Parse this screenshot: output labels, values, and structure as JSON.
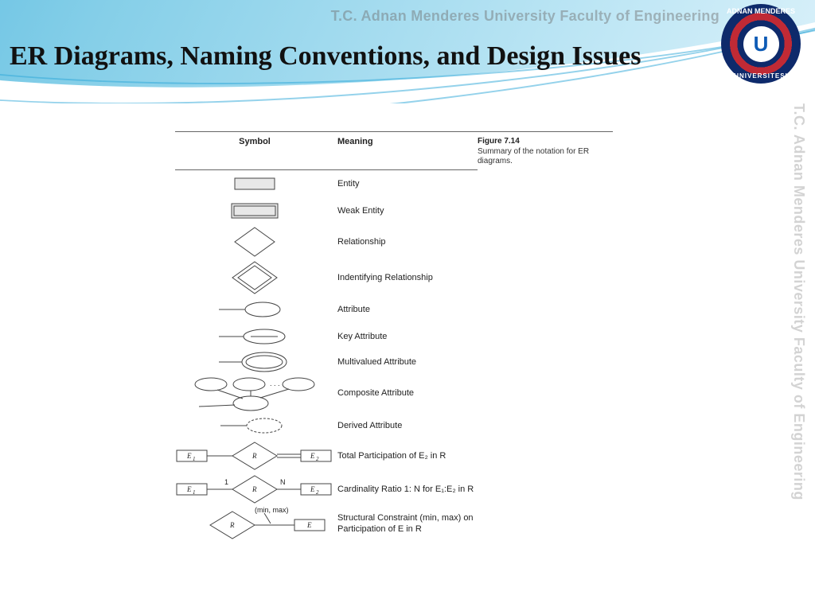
{
  "branding": {
    "header": "T.C.    Adnan Menderes University    Faculty of Engineering",
    "side": "T.C.    Adnan Menderes University    Faculty of Engineering",
    "seal_top": "ADNAN MENDERES",
    "seal_bottom": "UNIVERSITESI",
    "seal_letter": "U"
  },
  "title": "ER Diagrams, Naming Conventions, and Design Issues",
  "figure": {
    "header_symbol": "Symbol",
    "header_meaning": "Meaning",
    "caption_title": "Figure 7.14",
    "caption_text": "Summary of the notation for ER diagrams.",
    "rows": [
      {
        "meaning": "Entity"
      },
      {
        "meaning": "Weak Entity"
      },
      {
        "meaning": "Relationship"
      },
      {
        "meaning": "Indentifying Relationship"
      },
      {
        "meaning": "Attribute"
      },
      {
        "meaning": "Key Attribute"
      },
      {
        "meaning": "Multivalued Attribute"
      },
      {
        "meaning": "Composite Attribute"
      },
      {
        "meaning": "Derived Attribute"
      },
      {
        "meaning": "Total Participation of E₂ in R",
        "labels": {
          "e1": "E",
          "e1sub": "1",
          "e2": "E",
          "e2sub": "2",
          "r": "R"
        }
      },
      {
        "meaning": "Cardinality Ratio 1: N for E₁:E₂ in R",
        "labels": {
          "e1": "E",
          "e1sub": "1",
          "e2": "E",
          "e2sub": "2",
          "r": "R",
          "left": "1",
          "right": "N"
        }
      },
      {
        "meaning": "Structural Constraint (min, max) on Participation of E in R",
        "labels": {
          "e": "E",
          "r": "R",
          "minmax": "(min, max)"
        }
      }
    ]
  }
}
